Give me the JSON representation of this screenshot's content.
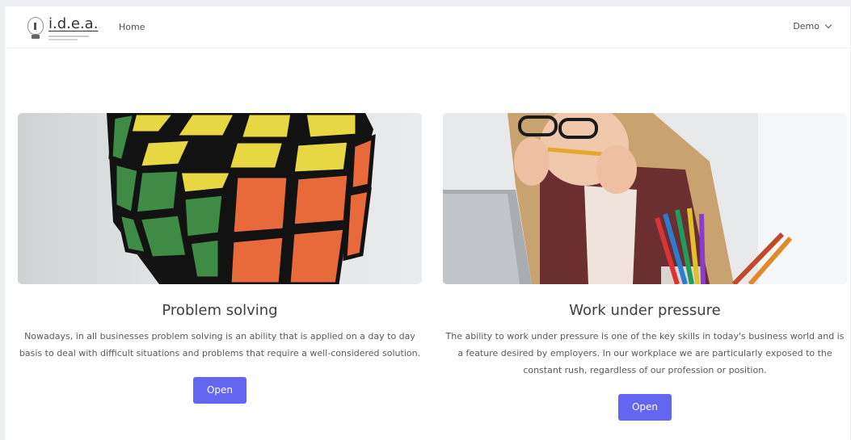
{
  "navbar": {
    "logo_text": "i.d.e.a.",
    "home_label": "Home",
    "demo_label": "Demo"
  },
  "cards": [
    {
      "title": "Problem solving",
      "text": "Nowadays, in all businesses problem solving is an ability that is applied on a day to day basis to deal with difficult situations and problems that require a well-considered solution.",
      "button_label": "Open",
      "image": "rubiks-cube-image"
    },
    {
      "title": "Work under pressure",
      "text": "The ability to work under pressure is one of the key skills in today's business world and is a feature desired by employers. In our workplace we are particularly exposed to the constant rush, regardless of our profession or position.",
      "button_label": "Open",
      "image": "stressed-woman-image"
    }
  ],
  "colors": {
    "accent": "#6366f1",
    "background": "#ffffff",
    "text": "#3b4046"
  }
}
